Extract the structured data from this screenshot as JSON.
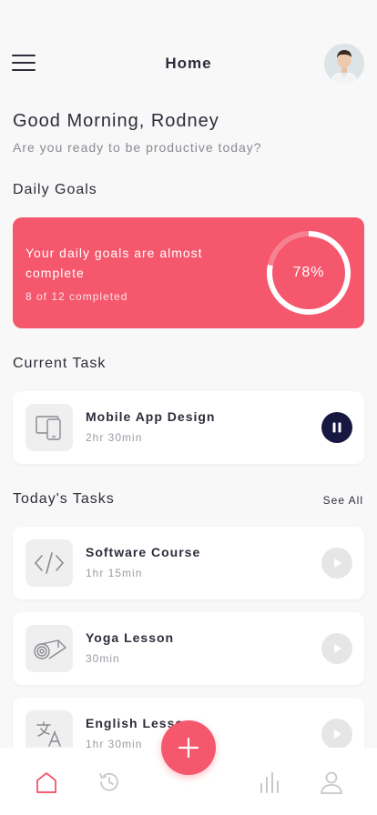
{
  "header": {
    "title": "Home"
  },
  "greeting": {
    "title": "Good Morning, Rodney",
    "subtitle": "Are you ready to be productive today?"
  },
  "daily_goals": {
    "section_title": "Daily Goals",
    "message": "Your daily goals are almost complete",
    "progress_text": "8 of 12 completed",
    "percent_label": "78%",
    "percent": 0.78
  },
  "current_task": {
    "section_title": "Current Task",
    "name": "Mobile App Design",
    "duration": "2hr 30min",
    "icon": "tablet-icon"
  },
  "todays_tasks": {
    "section_title": "Today's Tasks",
    "see_all": "See All",
    "items": [
      {
        "name": "Software Course",
        "duration": "1hr 15min",
        "icon": "code-icon"
      },
      {
        "name": "Yoga Lesson",
        "duration": "30min",
        "icon": "yoga-mat-icon"
      },
      {
        "name": "English Lesson",
        "duration": "1hr 30min",
        "icon": "translate-icon"
      }
    ]
  },
  "colors": {
    "accent": "#f5576c",
    "pause_button": "#171842",
    "background": "#f8f8f8"
  }
}
